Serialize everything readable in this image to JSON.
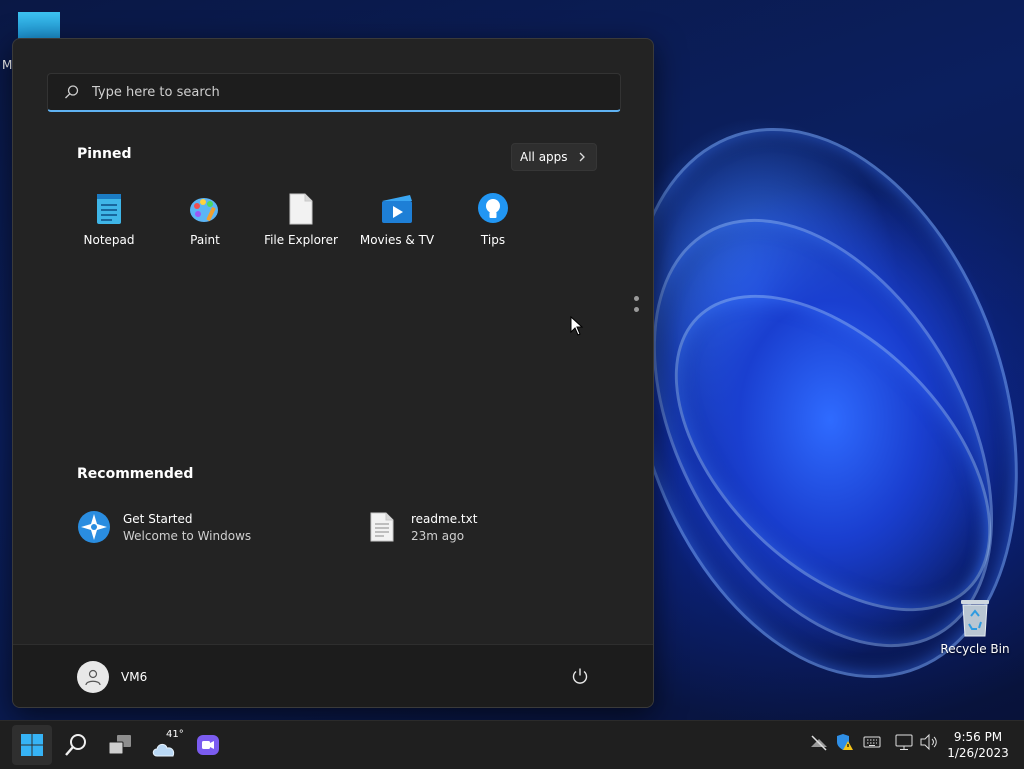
{
  "desktop": {
    "partial_label": "M",
    "recycle_bin_label": "Recycle Bin"
  },
  "start_menu": {
    "search": {
      "placeholder": "Type here to search",
      "value": ""
    },
    "pinned": {
      "title": "Pinned",
      "all_apps_label": "All apps",
      "apps": [
        {
          "name": "Notepad",
          "icon": "notepad-icon"
        },
        {
          "name": "Paint",
          "icon": "paint-icon"
        },
        {
          "name": "File Explorer",
          "icon": "file-icon"
        },
        {
          "name": "Movies & TV",
          "icon": "movies-icon"
        },
        {
          "name": "Tips",
          "icon": "tips-icon"
        }
      ]
    },
    "recommended": {
      "title": "Recommended",
      "items": [
        {
          "title": "Get Started",
          "subtitle": "Welcome to Windows",
          "icon": "get-started-icon"
        },
        {
          "title": "readme.txt",
          "subtitle": "23m ago",
          "icon": "text-file-icon"
        }
      ]
    },
    "user": {
      "name": "VM6"
    }
  },
  "taskbar": {
    "weather_temp": "41°",
    "clock": {
      "time": "9:56 PM",
      "date": "1/26/2023"
    }
  },
  "colors": {
    "accent": "#5fb2f2",
    "menu_bg": "#232323",
    "taskbar_bg": "#1f1f1f"
  }
}
